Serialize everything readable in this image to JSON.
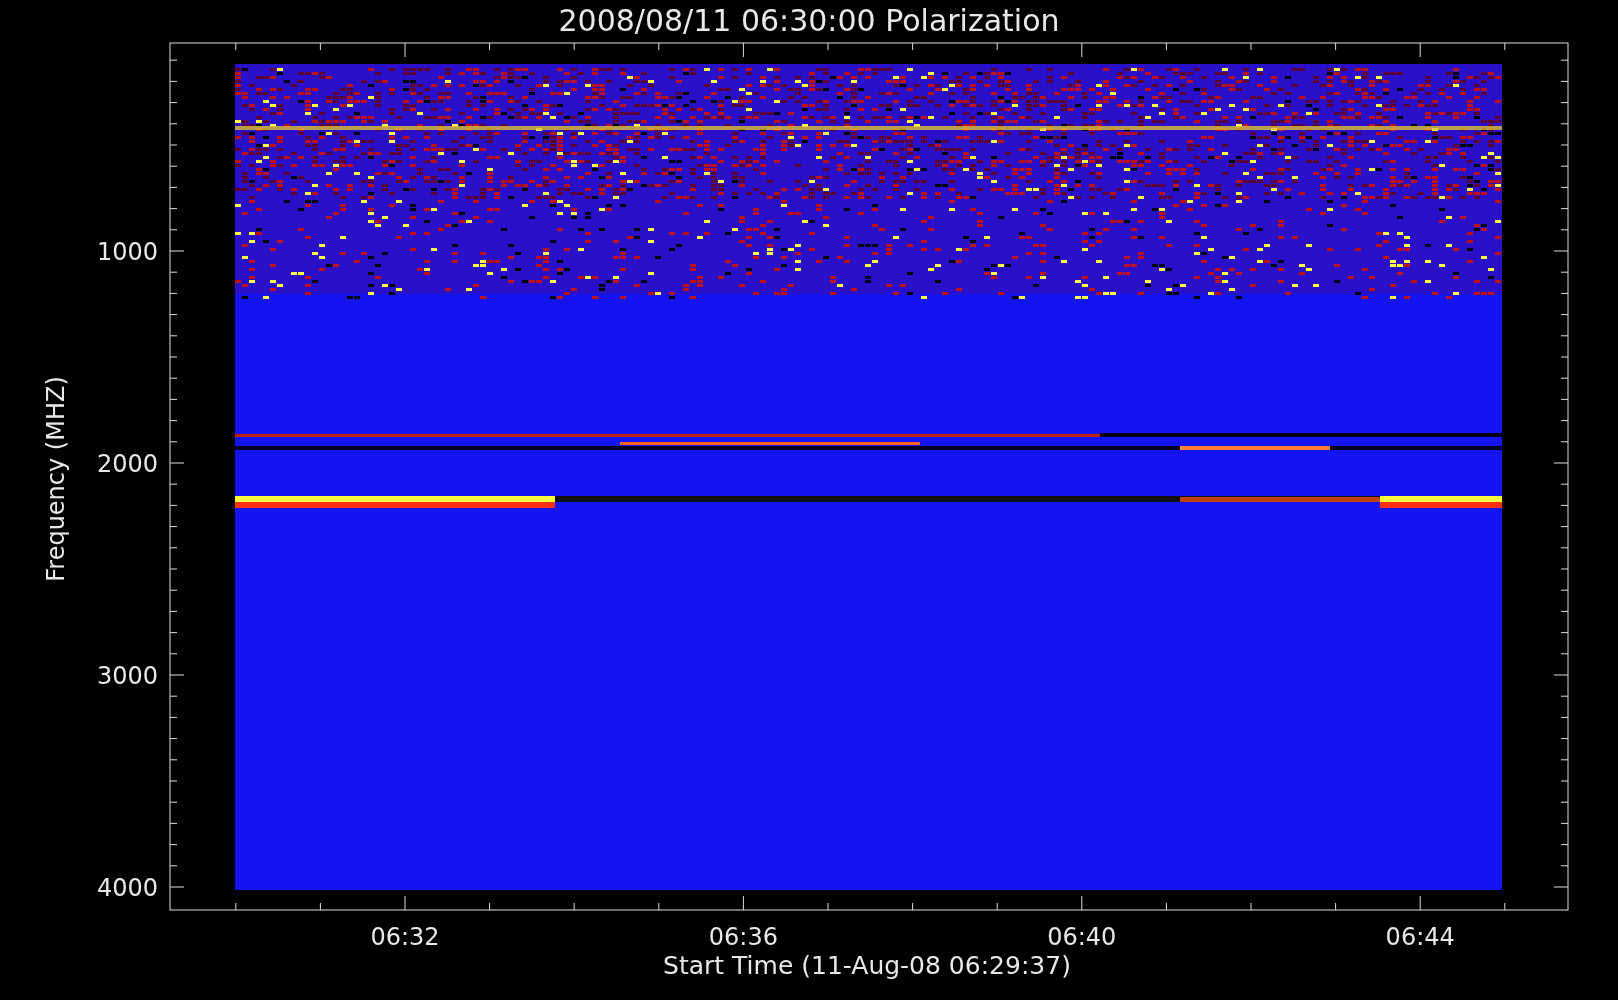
{
  "plot": {
    "title": "2008/08/11 06:30:00 Polarization",
    "xlabel": "Start Time (11-Aug-08 06:29:37)",
    "ylabel": "Frequency (MHZ)",
    "xtick_labels": [
      "06:32",
      "06:36",
      "06:40",
      "06:44"
    ],
    "ytick_labels": [
      "1000",
      "2000",
      "3000",
      "4000"
    ]
  }
}
